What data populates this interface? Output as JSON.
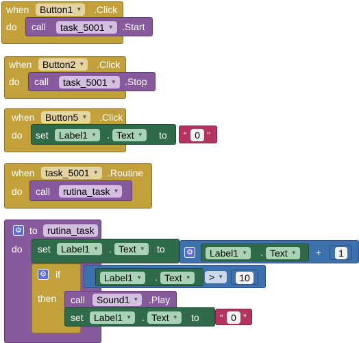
{
  "blocks": {
    "b1": {
      "when": "when",
      "component": "Button1",
      "event": ".Click",
      "do": "do",
      "call": "call",
      "target": "task_5001",
      "method": ".Start"
    },
    "b2": {
      "when": "when",
      "component": "Button2",
      "event": ".Click",
      "do": "do",
      "call": "call",
      "target": "task_5001",
      "method": ".Stop"
    },
    "b3": {
      "when": "when",
      "component": "Button5",
      "event": ".Click",
      "do": "do",
      "set": "set",
      "comp": "Label1",
      "dot": ".",
      "prop": "Text",
      "to": "to",
      "value": "0"
    },
    "b4": {
      "when": "when",
      "component": "task_5001",
      "event": ".Routine",
      "do": "do",
      "call": "call",
      "target": "rutina_task"
    },
    "b5": {
      "to": "to",
      "proc_name": "rutina_task",
      "do": "do",
      "set": "set",
      "comp": "Label1",
      "dot": ".",
      "prop": "Text",
      "to2": "to",
      "add_comp": "Label1",
      "add_prop": "Text",
      "plus": "+",
      "add_val": "1",
      "if": "if",
      "cmp_comp": "Label1",
      "cmp_prop": "Text",
      "op": ">",
      "cmp_val": "10",
      "then": "then",
      "call": "call",
      "sound": "Sound1",
      "play": ".Play",
      "set2": "set",
      "comp2": "Label1",
      "prop2": "Text",
      "to3": "to",
      "value2": "0"
    }
  },
  "colors": {
    "event": "#c3a13a",
    "procedure": "#875a9e",
    "component": "#2f6b4a",
    "math": "#3d71ae",
    "text": "#b43360"
  }
}
